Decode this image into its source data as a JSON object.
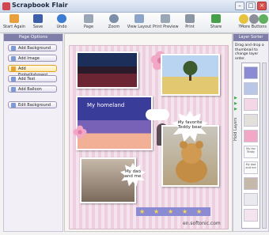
{
  "window": {
    "title": "Scrapbook Flair",
    "controls": [
      "–",
      "□",
      "×"
    ]
  },
  "toolbar": {
    "buttons": [
      {
        "label": "Start Again",
        "icon": "house-icon",
        "color": "#e7a03c"
      },
      {
        "label": "Save",
        "icon": "floppy-icon",
        "color": "#3c5fa8"
      },
      {
        "label": "Undo",
        "icon": "undo-arrow-icon",
        "color": "#3b7bd1"
      },
      {
        "label": "Page",
        "icon": "page-icon",
        "color": "#9aa6b5"
      },
      {
        "label": "Zoom",
        "icon": "magnifier-icon",
        "color": "#7d8fa8"
      },
      {
        "label": "View Layout",
        "icon": "layout-icon",
        "color": "#8ba4c8"
      },
      {
        "label": "Print Preview",
        "icon": "print-preview-icon",
        "color": "#9aa6b5"
      },
      {
        "label": "Print",
        "icon": "printer-icon",
        "color": "#8c96a3"
      },
      {
        "label": "Share",
        "icon": "share-icon",
        "color": "#46a04a"
      }
    ],
    "more_buttons": "?More Buttons"
  },
  "page_options": {
    "title": "Page Options",
    "buttons": [
      "Add Background",
      "Add Image",
      "Add Embellishment",
      "Add Text",
      "Add Balloon",
      "Edit Background"
    ],
    "active": "Add Embellishment"
  },
  "canvas": {
    "captions": {
      "homeland": "My homeland",
      "teddy": "My favorite Teddy bear",
      "dad": "My dad and me"
    },
    "watermark": "en.softonic.com"
  },
  "layer_sorter": {
    "title": "Layer Sorter",
    "instructions": "Drag and drop a thumbnail to change layer order.",
    "side_label": "Hold Layers",
    "layer_texts": [
      "My dad and me",
      "My fav Teddy"
    ]
  }
}
